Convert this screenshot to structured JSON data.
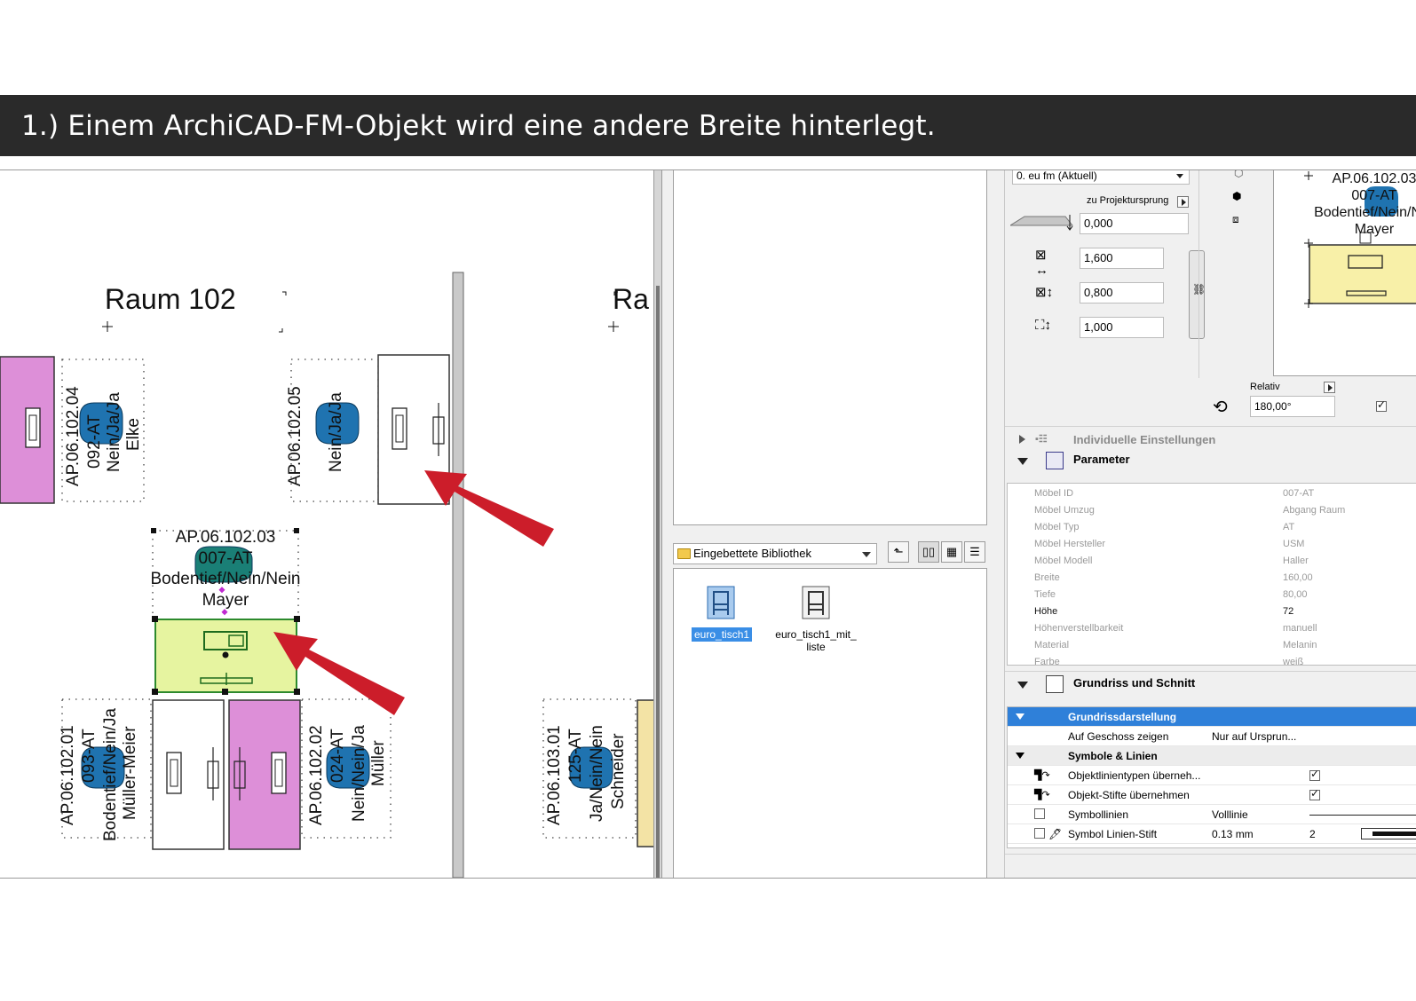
{
  "header": {
    "title": "1.) Einem ArchiCAD-FM-Objekt wird eine andere Breite hinterlegt."
  },
  "plan": {
    "room_left": "Raum 102",
    "room_right": "Ra",
    "ws_04": [
      "AP.06.102.04",
      "092-AT",
      "Nein/Ja/Ja",
      "Elke"
    ],
    "ws_05": [
      "AP.06.102.05",
      "Nein/Ja/Ja"
    ],
    "ws_03": [
      "AP.06.102.03",
      "007-AT",
      "Bodentief/Nein/Nein",
      "Mayer"
    ],
    "ws_01": [
      "AP.06.102.01",
      "093-AT",
      "Bodentief/Nein/Ja",
      "Müller-Meier"
    ],
    "ws_02": [
      "AP.06.102.02",
      "024-AT",
      "Nein/Nein/Ja",
      "Müller"
    ],
    "ws_103": [
      "AP.06.103.01",
      "125-AT",
      "Ja/Nein/Nein",
      "Schneider"
    ],
    "colors": {
      "pink": "#dd8fd8",
      "yellow_green": "#e6f4a0",
      "chair": "#1f73b0",
      "arrow": "#cc1d2a"
    }
  },
  "library": {
    "folder_label": "Eingebettete Bibliothek",
    "items": [
      {
        "label": "euro_tisch1",
        "selected": true,
        "icon": "chair-icon"
      },
      {
        "label": "euro_tisch1_mit_liste",
        "selected": false,
        "icon": "chair-icon"
      }
    ]
  },
  "settings": {
    "story_select": "0. eu fm (Aktuell)",
    "project_origin_label": "zu Projektursprung",
    "elevation": "0,000",
    "width": "1,600",
    "depth": "0,800",
    "height": "1,000",
    "relativ_label": "Relativ",
    "rotation": "180,00°",
    "preview_lines": [
      "AP.06.102.03",
      "007-AT",
      "Bodentief/Nein/Ne",
      "Mayer"
    ],
    "sections": {
      "individual": "Individuelle Einstellungen",
      "parameter": "Parameter",
      "floorplan": "Grundriss und Schnitt"
    },
    "params": [
      {
        "name": "Möbel ID",
        "value": "007-AT"
      },
      {
        "name": "Möbel Umzug",
        "value": "Abgang Raum"
      },
      {
        "name": "Möbel Typ",
        "value": "AT"
      },
      {
        "name": "Möbel Hersteller",
        "value": "USM"
      },
      {
        "name": "Möbel Modell",
        "value": "Haller"
      },
      {
        "name": "Breite",
        "value": "160,00"
      },
      {
        "name": "Tiefe",
        "value": "80,00"
      },
      {
        "name": "Höhe",
        "value": "72"
      },
      {
        "name": "Höhenverstellbarkeit",
        "value": "manuell"
      },
      {
        "name": "Material",
        "value": "Melanin"
      },
      {
        "name": "Farbe",
        "value": "weiß"
      }
    ],
    "grid": {
      "grundriss_header": "Grundrissdarstellung",
      "geschoss_label": "Auf Geschoss zeigen",
      "geschoss_value": "Nur auf Ursprun...",
      "symbole_header": "Symbole & Linien",
      "linientypen_label": "Objektlinientypen überneh...",
      "stifte_label": "Objekt-Stifte übernehmen",
      "symbollinien_label": "Symbollinien",
      "symbollinien_value": "Volllinie",
      "linienstift_label": "Symbol Linien-Stift",
      "linienstift_value": "0.13 mm",
      "linienstift_number": "2"
    }
  }
}
